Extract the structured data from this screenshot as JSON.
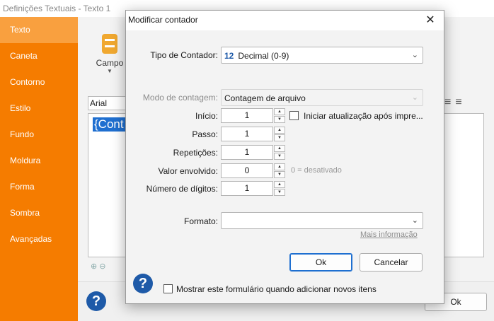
{
  "background": {
    "window_title": "Definições Textuais - Texto 1",
    "sidebar": [
      "Texto",
      "Caneta",
      "Contorno",
      "Estilo",
      "Fundo",
      "Moldura",
      "Forma",
      "Sombra",
      "Avançadas"
    ],
    "tool_label": "Campo",
    "font_name": "Arial",
    "editor_text": "{Cont",
    "ok_label": "Ok"
  },
  "dialog": {
    "title": "Modificar contador",
    "counter_type_label": "Tipo de Contador:",
    "counter_type_tag": "12",
    "counter_type_value": "Decimal (0-9)",
    "count_mode_label": "Modo de contagem:",
    "count_mode_value": "Contagem de arquivo",
    "start_label": "Início:",
    "start_value": "1",
    "start_checkbox_label": "Iniciar atualização após impre...",
    "step_label": "Passo:",
    "step_value": "1",
    "repeat_label": "Repetições:",
    "repeat_value": "1",
    "wrap_label": "Valor envolvido:",
    "wrap_value": "0",
    "wrap_hint": "0 = desativado",
    "digits_label": "Número de dígitos:",
    "digits_value": "1",
    "format_label": "Formato:",
    "format_value": "",
    "more_info": "Mais informação",
    "ok": "Ok",
    "cancel": "Cancelar",
    "show_form_label": "Mostrar este formulário quando adicionar novos itens"
  },
  "icons": {
    "close": "close-icon",
    "help": "help-icon",
    "spin_up": "▲",
    "spin_down": "▼",
    "caret": "⌄",
    "help_glyph": "?"
  },
  "colors": {
    "sidebar": "#f57c00",
    "sidebar_active": "#f9a03f",
    "accent": "#1e6fd0",
    "help_blue": "#1e5aa8"
  }
}
